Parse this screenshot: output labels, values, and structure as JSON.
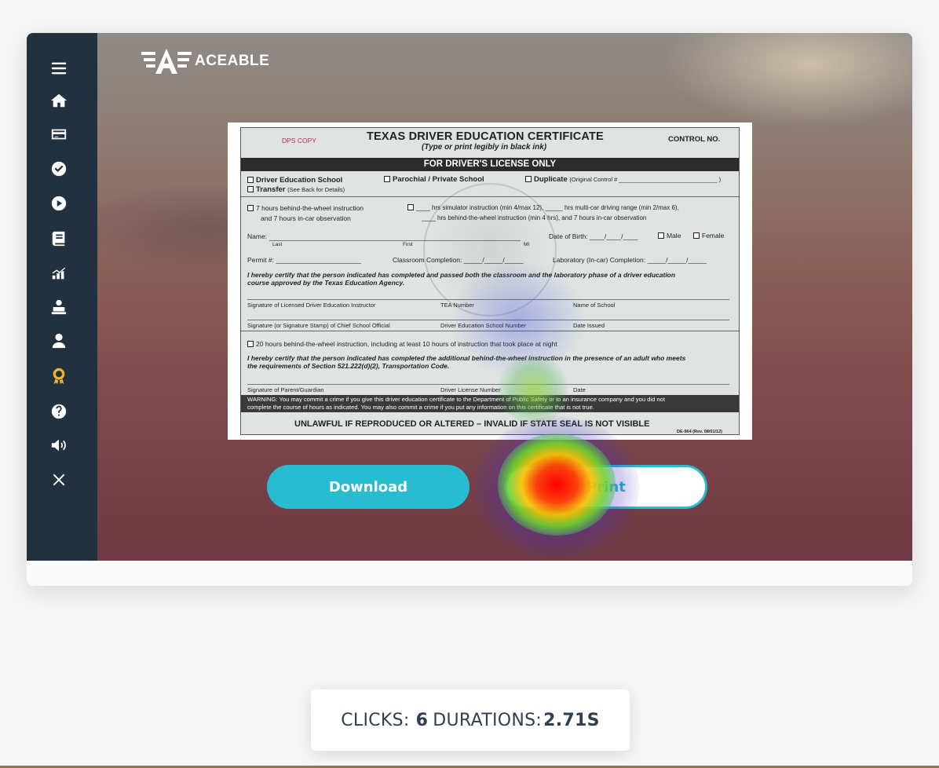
{
  "app": {
    "logo_text": "ACEABLE"
  },
  "sidebar": {
    "items": [
      {
        "name": "menu-icon"
      },
      {
        "name": "home-icon"
      },
      {
        "name": "credit-card-icon"
      },
      {
        "name": "check-circle-icon"
      },
      {
        "name": "play-circle-icon"
      },
      {
        "name": "book-icon"
      },
      {
        "name": "progress-chart-icon"
      },
      {
        "name": "instructor-icon"
      },
      {
        "name": "user-icon"
      },
      {
        "name": "certificate-award-icon",
        "active": true
      },
      {
        "name": "help-icon"
      },
      {
        "name": "volume-icon"
      },
      {
        "name": "close-icon"
      }
    ],
    "active_color": "#f1b434"
  },
  "certificate": {
    "dps_copy": "DPS COPY",
    "title": "TEXAS DRIVER EDUCATION CERTIFICATE",
    "subtitle": "(Type or print legibly in black ink)",
    "control_no": "CONTROL NO.",
    "banner": "FOR DRIVER'S LICENSE ONLY",
    "driver_ed_school": "Driver Education School",
    "parochial": "Parochial / Private School",
    "duplicate": "Duplicate",
    "duplicate_note": "(Original Control # ______________________________ )",
    "transfer": "Transfer",
    "transfer_note": "(See Back for Details)",
    "bw_7_line1": "7 hours behind-the-wheel instruction",
    "bw_7_line2": "and 7 hours in-car observation",
    "sim_line1": "____ hrs simulator instruction (min 4/max 12), _____ hrs multi-car driving range (min 2/max 6),",
    "sim_line2": "____ hrs behind-the-wheel instruction (min 4 hrs), and 7 hours in-car observation",
    "name_label": "Name:",
    "last": "Last",
    "first": "First",
    "mi": "MI",
    "dob": "Date of Birth: ____/____/____",
    "male": "Male",
    "female": "Female",
    "permit": "Permit #: _______________________",
    "classroom": "Classroom Completion: _____/_____/_____",
    "lab": "Laboratory (In-car) Completion: _____/_____/_____",
    "certify1": "I hereby certify that the person indicated has completed and passed both the classroom and the laboratory phase of a driver education",
    "certify1b": "course approved by the Texas Education Agency.",
    "sig_instructor": "Signature of Licensed Driver Education Instructor",
    "tea_number": "TEA Number",
    "name_school": "Name of School",
    "sig_official": "Signature (or Signature Stamp) of Chief School Official",
    "school_number": "Driver Education School Number",
    "date_issued": "Date Issued",
    "bw_20": "20 hours behind-the-wheel instruction, including at least 10 hours of instruction that took place at night",
    "certify2": "I hereby certify that the person indicated has completed the additional behind-the-wheel instruction in the presence of an adult who meets",
    "certify2b": "the requirements of Section 521.222(d)(2), Transportation Code.",
    "sig_parent": "Signature of Parent/Guardian",
    "dl_number": "Driver License Number",
    "date": "Date",
    "warning1": "WARNING:  You may commit a crime if you give this driver education certificate to the Department of Public Safety or to an insurance company and you did not",
    "warning2": "complete the course of hours as indicated.  You may also commit a crime if you put any information on this certificate that is not true.",
    "footer": "UNLAWFUL IF REPRODUCED OR ALTERED – INVALID IF STATE SEAL IS NOT VISIBLE",
    "form_no": "DE-964 (Rev. 08/01/12)"
  },
  "actions": {
    "download_label": "Download",
    "print_label": "Print",
    "accent": "#27bccf"
  },
  "stats": {
    "clicks_label": "CLICKS:",
    "clicks_value": "6",
    "durations_label": "DURATIONS:",
    "durations_value": "2.71S"
  }
}
